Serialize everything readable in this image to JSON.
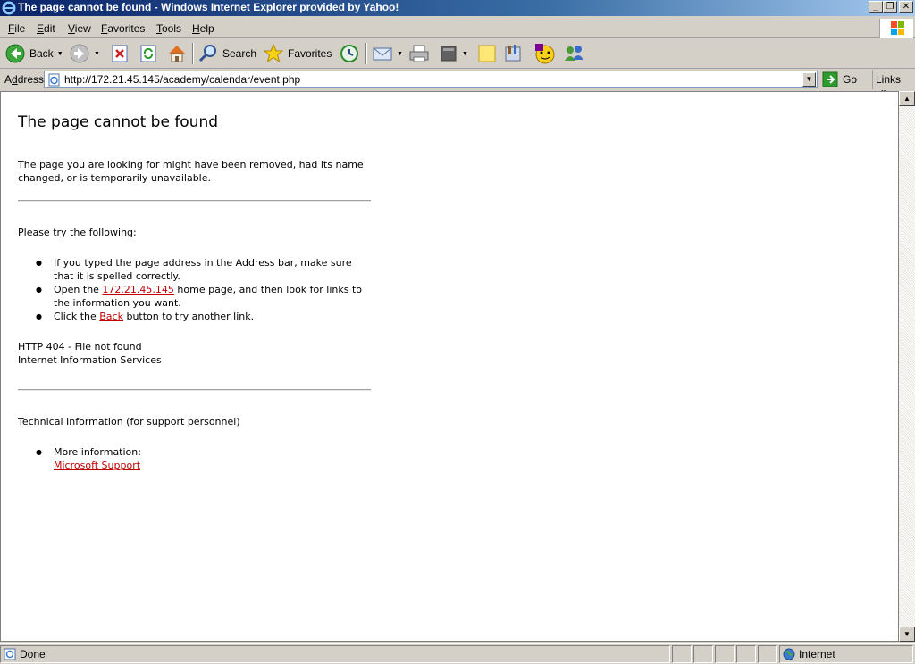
{
  "window": {
    "title": "The page cannot be found - Windows Internet Explorer provided by Yahoo!",
    "minimize": "_",
    "maximize": "❐",
    "close": "✕"
  },
  "menu": {
    "items": [
      {
        "label": "File",
        "key": "F",
        "rest": "ile"
      },
      {
        "label": "Edit",
        "key": "E",
        "rest": "dit"
      },
      {
        "label": "View",
        "key": "V",
        "rest": "iew"
      },
      {
        "label": "Favorites",
        "key": "F",
        "rest": "avorites",
        "pre": ""
      },
      {
        "label": "Tools",
        "key": "T",
        "rest": "ools"
      },
      {
        "label": "Help",
        "key": "H",
        "rest": "elp"
      }
    ]
  },
  "toolbar": {
    "back_label": "Back",
    "search_label": "Search",
    "favorites_label": "Favorites"
  },
  "address": {
    "label_pre": "A",
    "label_key": "d",
    "label_post": "dress",
    "url": "http://172.21.45.145/academy/calendar/event.php",
    "go_label": "Go",
    "links_label": "Links",
    "links_chevron": "»"
  },
  "page": {
    "heading": "The page cannot be found",
    "intro": "The page you are looking for might have been removed, had its name changed, or is temporarily unavailable.",
    "try_heading": "Please try the following:",
    "bullet1": "If you typed the page address in the Address bar, make sure that it is spelled correctly.",
    "bullet2_pre": "Open the ",
    "bullet2_link": "172.21.45.145",
    "bullet2_post": " home page, and then look for links to the information you want.",
    "bullet3_pre": "Click the ",
    "bullet3_link": "Back",
    "bullet3_post": " button to try another link.",
    "error_code": "HTTP 404 - File not found",
    "server": "Internet Information Services",
    "tech_heading": "Technical Information (for support personnel)",
    "more_info": "More information:",
    "support_link": "Microsoft Support"
  },
  "status": {
    "text": "Done",
    "zone": "Internet"
  }
}
